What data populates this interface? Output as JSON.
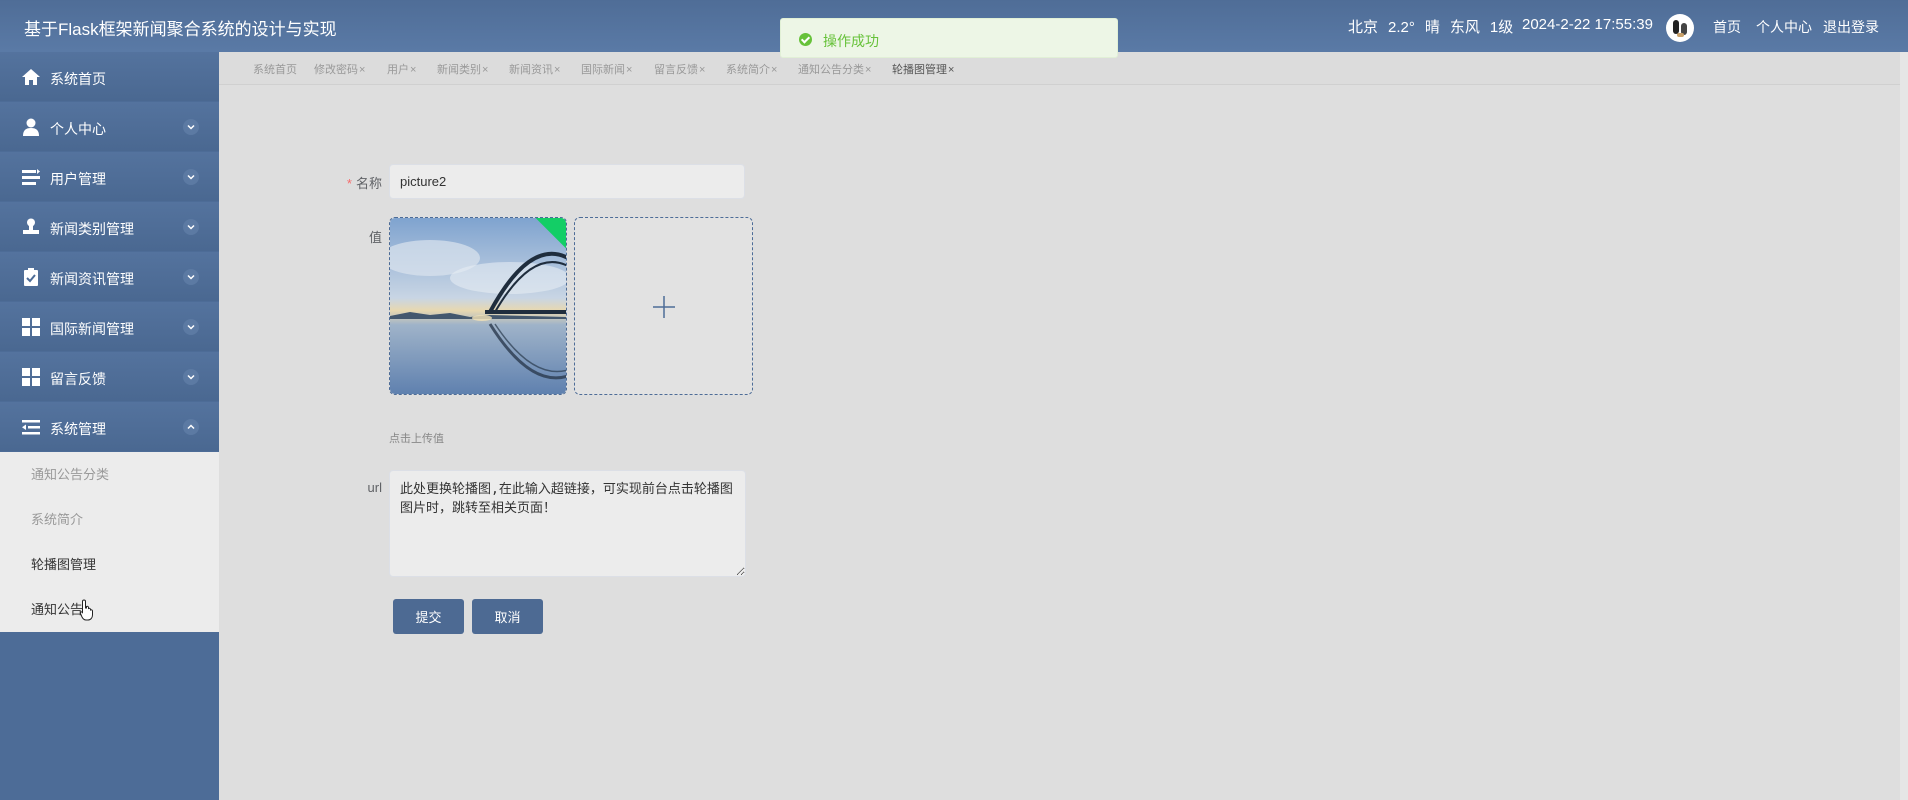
{
  "header": {
    "title": "基于Flask框架新闻聚合系统的设计与实现",
    "weather": {
      "city": "北京",
      "temp": "2.2°",
      "condition": "晴",
      "wind": "东风",
      "level": "1级"
    },
    "datetime": "2024-2-22 17:55:39",
    "links": {
      "home": "首页",
      "profile": "个人中心",
      "logout": "退出登录"
    }
  },
  "toast": {
    "text": "操作成功",
    "color": "#67c23a"
  },
  "sidebar": {
    "items": [
      {
        "label": "系统首页",
        "icon": "home-icon"
      },
      {
        "label": "个人中心",
        "icon": "user-icon"
      },
      {
        "label": "用户管理",
        "icon": "list-icon"
      },
      {
        "label": "新闻类别管理",
        "icon": "stamp-icon"
      },
      {
        "label": "新闻资讯管理",
        "icon": "clipboard-check-icon"
      },
      {
        "label": "国际新闻管理",
        "icon": "grid-icon"
      },
      {
        "label": "留言反馈",
        "icon": "grid-icon"
      },
      {
        "label": "系统管理",
        "icon": "menu-indent-icon"
      }
    ],
    "submenu": [
      "通知公告分类",
      "系统简介",
      "轮播图管理",
      "通知公告"
    ]
  },
  "tabs": [
    "系统首页",
    "修改密码",
    "用户",
    "新闻类别",
    "新闻资讯",
    "国际新闻",
    "留言反馈",
    "系统简介",
    "通知公告分类",
    "轮播图管理"
  ],
  "tab_close": "×",
  "form": {
    "name_label": "名称",
    "required_mark": "*",
    "name_value": "picture2",
    "value_label": "值",
    "upload_tip": "点击上传值",
    "url_label": "url",
    "url_value": "此处更换轮播图,在此输入超链接，可实现前台点击轮播图图片时，跳转至相关页面！",
    "submit": "提交",
    "cancel": "取消"
  },
  "colors": {
    "brand": "#4d6c97",
    "success": "#67c23a",
    "required": "#f56c6c"
  }
}
